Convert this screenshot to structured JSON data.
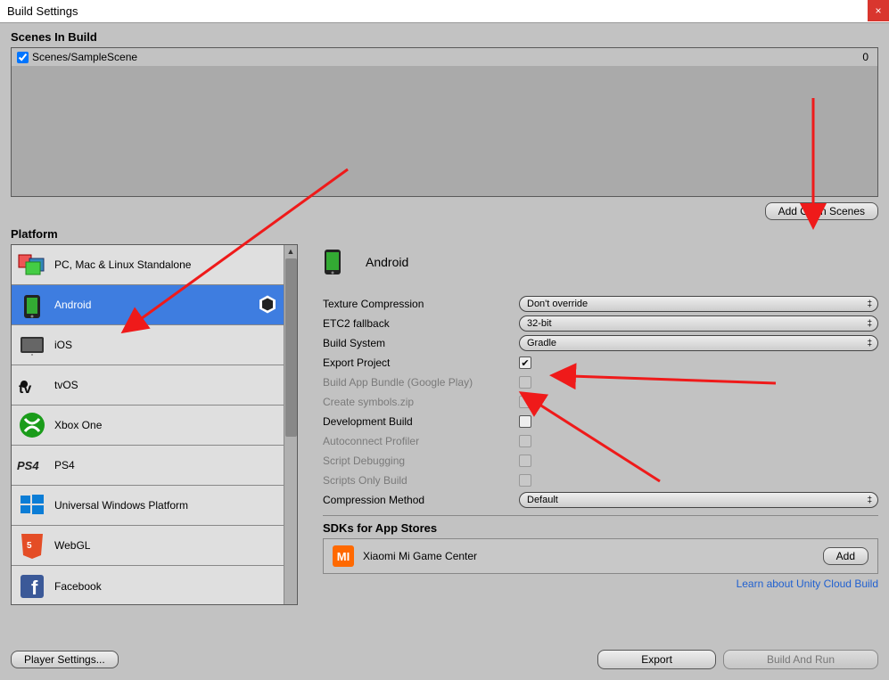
{
  "window": {
    "title": "Build Settings"
  },
  "scenes": {
    "section_label": "Scenes In Build",
    "rows": [
      {
        "name": "Scenes/SampleScene",
        "index": "0",
        "checked": true
      }
    ],
    "add_open_label": "Add Open Scenes"
  },
  "platform": {
    "section_label": "Platform",
    "items": [
      {
        "key": "standalone",
        "label": "PC, Mac & Linux Standalone"
      },
      {
        "key": "android",
        "label": "Android",
        "selected": true,
        "has_unity_badge": true
      },
      {
        "key": "ios",
        "label": "iOS"
      },
      {
        "key": "tvos",
        "label": "tvOS"
      },
      {
        "key": "xboxone",
        "label": "Xbox One"
      },
      {
        "key": "ps4",
        "label": "PS4"
      },
      {
        "key": "uwp",
        "label": "Universal Windows Platform"
      },
      {
        "key": "webgl",
        "label": "WebGL"
      },
      {
        "key": "facebook",
        "label": "Facebook"
      }
    ]
  },
  "right": {
    "title": "Android",
    "options": {
      "texture_compression": {
        "label": "Texture Compression",
        "value": "Don't override"
      },
      "etc2": {
        "label": "ETC2 fallback",
        "value": "32-bit"
      },
      "build_system": {
        "label": "Build System",
        "value": "Gradle"
      },
      "export_project": {
        "label": "Export Project",
        "checked": true
      },
      "app_bundle": {
        "label": "Build App Bundle (Google Play)",
        "disabled": true,
        "checked": false
      },
      "symbols": {
        "label": "Create symbols.zip",
        "disabled": true,
        "checked": false
      },
      "dev_build": {
        "label": "Development Build",
        "checked": false
      },
      "autoconnect": {
        "label": "Autoconnect Profiler",
        "disabled": true,
        "checked": false
      },
      "script_debug": {
        "label": "Script Debugging",
        "disabled": true,
        "checked": false
      },
      "scripts_only": {
        "label": "Scripts Only Build",
        "disabled": true,
        "checked": false
      },
      "compression": {
        "label": "Compression Method",
        "value": "Default"
      }
    },
    "sdk": {
      "header": "SDKs for App Stores",
      "item": "Xiaomi Mi Game Center",
      "add_label": "Add"
    },
    "cloud_link": "Learn about Unity Cloud Build"
  },
  "bottom": {
    "player_settings": "Player Settings...",
    "export": "Export",
    "build_run": "Build And Run"
  }
}
